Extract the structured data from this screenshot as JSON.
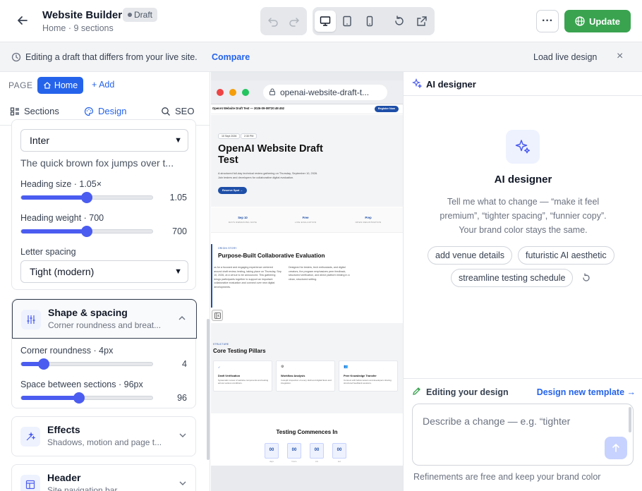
{
  "topbar": {
    "title": "Website Builder",
    "badge": "Draft",
    "subtitle": "Home · 9 sections",
    "update_label": "Update",
    "more_label": "···",
    "brand_color": "#3aa350"
  },
  "banner": {
    "message": "Editing a draft that differs from your live site.",
    "compare_label": "Compare",
    "load_label": "Load live design",
    "close_label": "×"
  },
  "left": {
    "page_label": "PAGE",
    "home_label": "Home",
    "add_label": "+ Add",
    "tabs": [
      {
        "label": "Sections",
        "icon": "sections-icon"
      },
      {
        "label": "Design",
        "icon": "palette-icon"
      },
      {
        "label": "SEO",
        "icon": "search-icon"
      }
    ],
    "typography": {
      "font_value": "Inter",
      "sample_text": "The quick brown fox jumps over t...",
      "heading_size_label": "Heading size · 1.05×",
      "heading_size_value": "1.05",
      "heading_size_fraction": 0.5,
      "heading_weight_label": "Heading weight · 700",
      "heading_weight_value": "700",
      "heading_weight_fraction": 0.5,
      "letter_spacing_label": "Letter spacing",
      "letter_spacing_value": "Tight (modern)"
    },
    "shape": {
      "title": "Shape & spacing",
      "subtitle": "Corner roundness and breat...",
      "corner_label": "Corner roundness · 4px",
      "corner_value": "4",
      "corner_fraction": 0.17,
      "space_label": "Space between sections · 96px",
      "space_value": "96",
      "space_fraction": 0.44
    },
    "effects": {
      "title": "Effects",
      "subtitle": "Shadows, motion and page t..."
    },
    "header": {
      "title": "Header",
      "subtitle": "Site navigation bar"
    }
  },
  "preview": {
    "url": "openai-website-draft-t...",
    "nav_text": "OpenAI Website Draft Test — 2026-09-09T20:49:452",
    "register_label": "Register Now",
    "meta_date": "10 Sept 2026",
    "meta_time": "2:30 PM",
    "hero_title": "OpenAI Website Draft Test",
    "hero_desc": "A structured full-day technical review gathering on Thursday, September 10, 2026. Join testers and developers for collaborative digital evaluation.",
    "hero_cta": "Reserve Spot →",
    "stats": [
      {
        "value": "Sep 10",
        "label": "DAYS REMAINING DATE"
      },
      {
        "value": "Free",
        "label": "LIVE EVALUATION"
      },
      {
        "value": "Prep",
        "label": "OPEN REGISTRATION"
      }
    ],
    "about_kicker": "ORIGIN STORY",
    "about_title": "Purpose-Built Collaborative Evaluation",
    "about_left": "Join us for a focused and engaging experience centered around draft review, testing, taking place on Thursday, Sep 10, 2026, at a venue to be announced. This gathering brings participants together to support an important collaborative evaluation and connect over new digital developments.",
    "about_right": "Designed for testers, tech enthusiasts, and digital creators, the program emphasizes peer feedback, structured verification, and direct platform testing in a clean, structured setting.",
    "pillars_kicker": "STRUCTURE",
    "pillars_title": "Core Testing Pillars",
    "pillars": [
      {
        "title": "Draft Verification",
        "desc": "Systematic review of website components and testing across various conditions."
      },
      {
        "title": "Workflow Analysis",
        "desc": "In-depth inspection of every draft and digital flows and integration."
      },
      {
        "title": "Peer Knowledge Transfer",
        "desc": "Connect with fellow testers and developers sharing structured feedback sessions."
      }
    ],
    "countdown_title": "Testing Commences In",
    "countdown": [
      {
        "value": "00",
        "label": "days"
      },
      {
        "value": "00",
        "label": "hours"
      },
      {
        "value": "00",
        "label": "min"
      },
      {
        "value": "00",
        "label": "sec"
      }
    ]
  },
  "ai": {
    "header": "AI designer",
    "title": "AI designer",
    "description": "Tell me what to change — “make it feel premium”, “tighter spacing”, “funnier copy”. Your brand color stays the same.",
    "chips": [
      "add venue details",
      "futuristic AI aesthetic",
      "streamline testing schedule"
    ],
    "editing_label": "Editing your design",
    "new_template_label": "Design new template →",
    "input_placeholder": "Describe a change — e.g. “tighter",
    "footer": "Refinements are free and keep your brand color"
  }
}
